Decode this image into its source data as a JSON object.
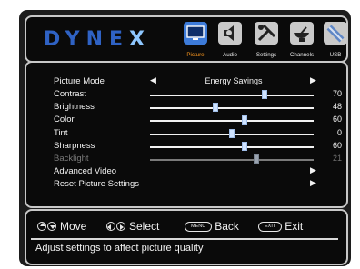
{
  "brand": {
    "text": "DYNE",
    "text_x": "X"
  },
  "tabs": [
    {
      "label": "Picture",
      "icon": "monitor-icon",
      "active": true
    },
    {
      "label": "Audio",
      "icon": "speaker-icon",
      "active": false
    },
    {
      "label": "Settings",
      "icon": "tools-icon",
      "active": false
    },
    {
      "label": "Channels",
      "icon": "satellite-dish-icon",
      "active": false
    },
    {
      "label": "USB",
      "icon": "usb-icon",
      "active": false
    }
  ],
  "menu": {
    "picture_mode": {
      "label": "Picture Mode",
      "value": "Energy Savings"
    },
    "contrast": {
      "label": "Contrast",
      "value": "70",
      "level": 0.7
    },
    "brightness": {
      "label": "Brightness",
      "value": "48",
      "level": 0.4
    },
    "color": {
      "label": "Color",
      "value": "60",
      "level": 0.58
    },
    "tint": {
      "label": "Tint",
      "value": "0",
      "level": 0.5
    },
    "sharpness": {
      "label": "Sharpness",
      "value": "60",
      "level": 0.58
    },
    "backlight": {
      "label": "Backlight",
      "value": "21",
      "level": 0.65,
      "disabled": true
    },
    "advanced_video": {
      "label": "Advanced Video"
    },
    "reset": {
      "label": "Reset Picture Settings"
    }
  },
  "footer": {
    "move": "Move",
    "select": "Select",
    "menu_key": "MENU",
    "back": "Back",
    "exit_key": "EXIT",
    "exit": "Exit",
    "status": "Adjust settings to affect picture quality"
  },
  "colors": {
    "active_tab": "#3d7bd9",
    "active_label": "#ff9a1f",
    "brand": "#2f62c4"
  }
}
